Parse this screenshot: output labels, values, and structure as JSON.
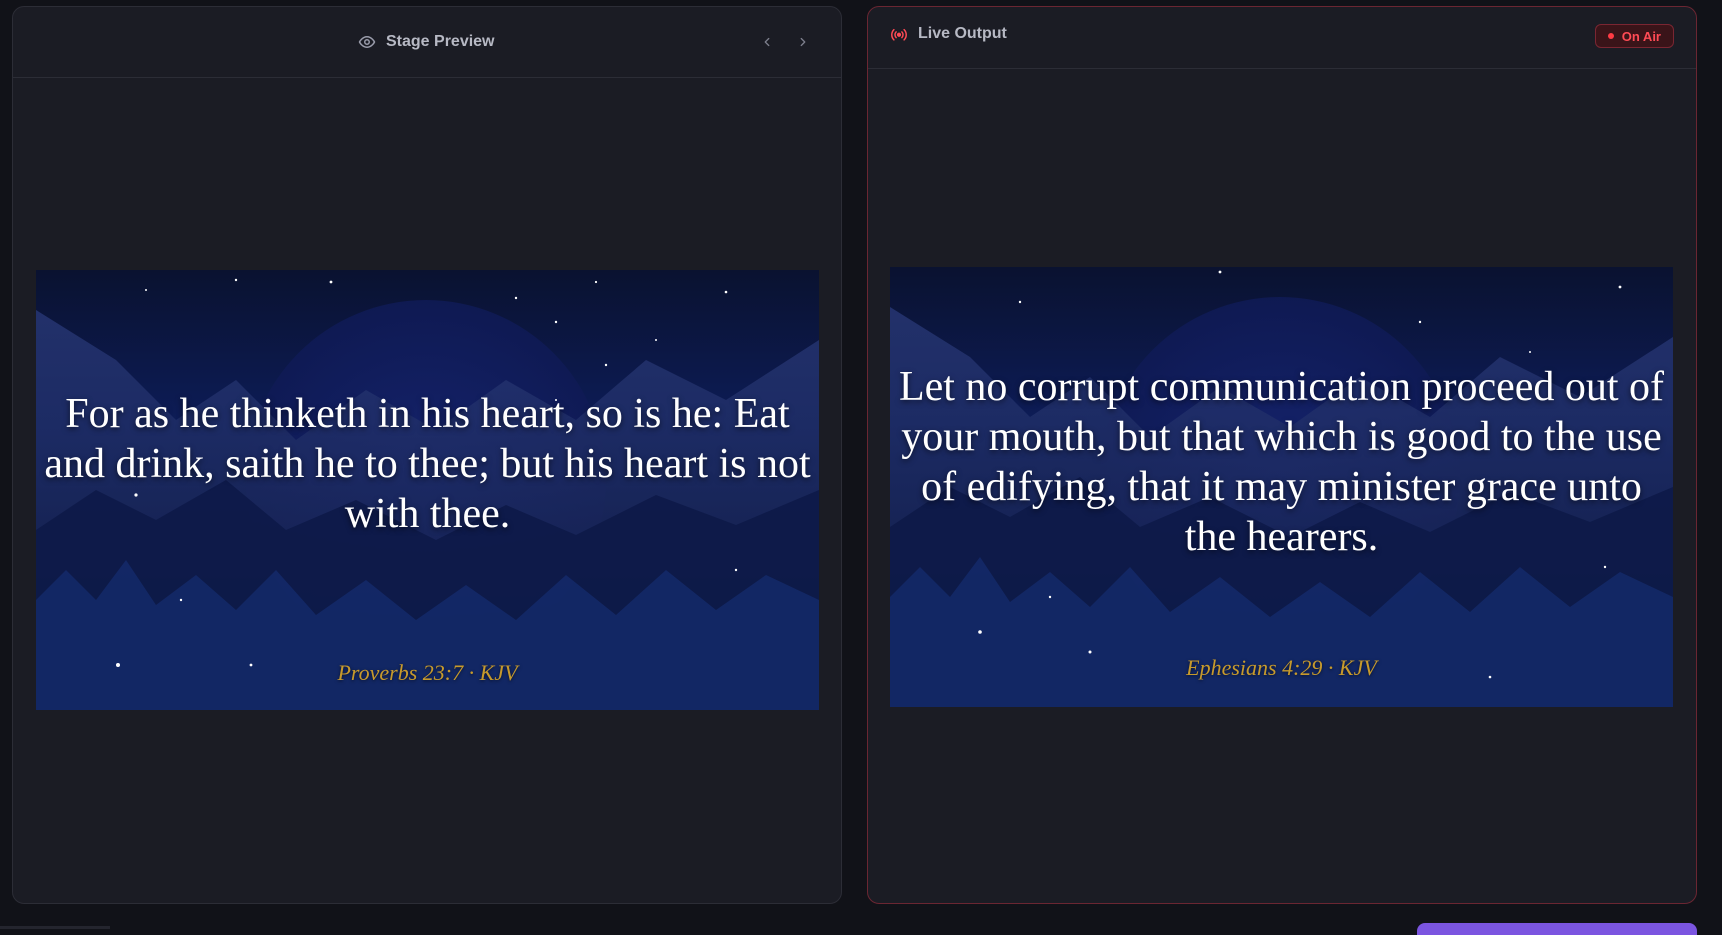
{
  "stage_preview": {
    "title": "Stage Preview",
    "icon": "eye-icon",
    "nav": {
      "prev_icon": "chevron-left-icon",
      "next_icon": "chevron-right-icon"
    },
    "slide": {
      "verse": "For as he thinketh in his heart, so is he: Eat and drink, saith he to thee; but his heart is not with thee.",
      "reference": "Proverbs 23:7 · KJV"
    }
  },
  "live_output": {
    "title": "Live Output",
    "icon": "broadcast-icon",
    "status_badge": "On Air",
    "slide": {
      "verse": "Let no corrupt communication proceed out of your mouth, but that which is good to the use of edifying, that it may minister grace unto the hearers.",
      "reference": "Ephesians 4:29 · KJV"
    }
  },
  "colors": {
    "accent": "#7b55e0",
    "live_border": "#6b2632",
    "on_air": "#ff4b55",
    "reference_gold": "#c79a2c"
  }
}
